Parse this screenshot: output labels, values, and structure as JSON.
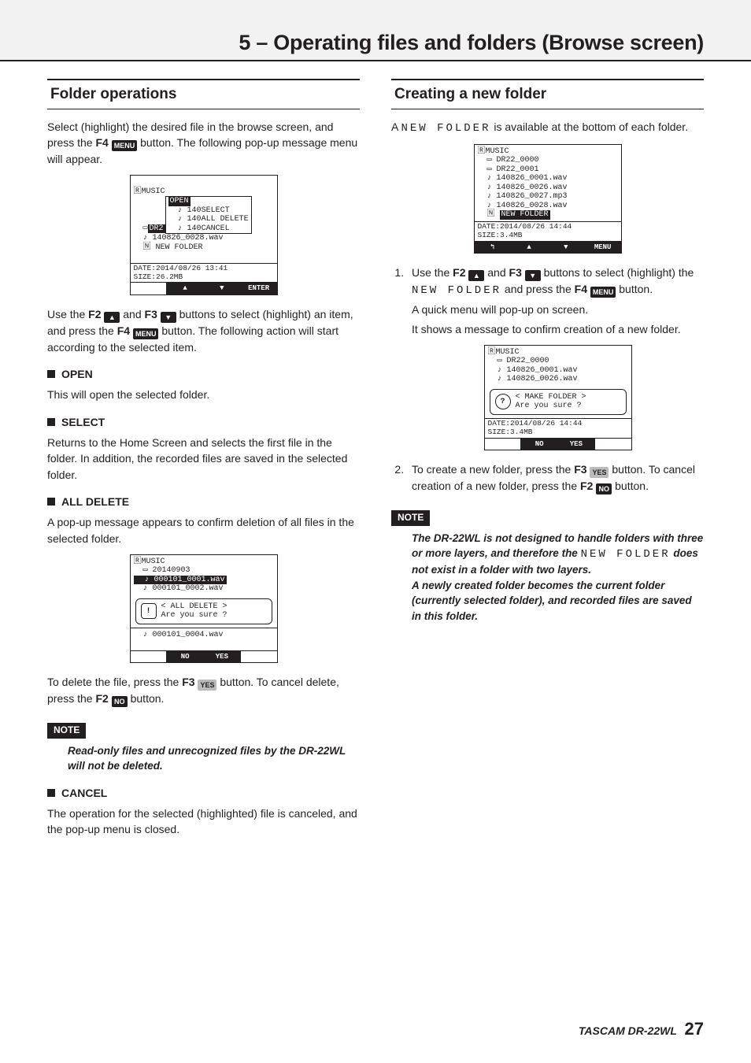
{
  "header": {
    "title": "5 – Operating files and folders (Browse screen)"
  },
  "left": {
    "h": "Folder operations",
    "intro_a": "Select (highlight) the desired file in the browse screen, and press the ",
    "intro_b_key": "F4",
    "intro_b_btn": "MENU",
    "intro_c": " button. The following pop-up message menu will appear.",
    "shot1": {
      "top": "🅁MUSIC",
      "l1f": "  ▭",
      "l1h": "DR2",
      "p1": "OPEN",
      "l2": "  ♪ 140",
      "p2": "SELECT",
      "l3": "  ♪ 140",
      "p3": "ALL DELETE",
      "l4": "  ♪ 140",
      "p4": "CANCEL",
      "l5": "  ♪ 140826_0028.wav",
      "l6": "  🄽 NEW FOLDER",
      "status": "DATE:2014/08/26 13:41\nSIZE:26.2MB",
      "f1": "",
      "f2": "▲",
      "f3": "▼",
      "f4": "ENTER"
    },
    "use_a": "Use the ",
    "use_f2": "F2",
    "use_up": "▲",
    "use_b": " and ",
    "use_f3": "F3",
    "use_dn": "▼",
    "use_c": " buttons to select (highlight) an item, and press the ",
    "use_f4": "F4",
    "use_menu": "MENU",
    "use_d": " button. The following action will start according to the selected item.",
    "open_h": "OPEN",
    "open_p": "This will open the selected folder.",
    "select_h": "SELECT",
    "select_p": "Returns to the Home Screen and selects the first file in the folder. In addition, the recorded files are saved in the selected folder.",
    "alldel_h": "ALL DELETE",
    "alldel_p": "A pop-up message appears to confirm deletion of all files in the selected folder.",
    "shot2": {
      "top": "🅁MUSIC",
      "l1": "  ▭ 20140903",
      "l2": "  ♪ 000101_0001.wav",
      "l3": "  ♪ 000101_0002.wav",
      "dlg_icon": "!",
      "dlg_l1": "< ALL DELETE >",
      "dlg_l2": "Are you sure ?",
      "l4": "  ♪ 000101_0004.wav",
      "f1": "",
      "f2": "NO",
      "f3": "YES",
      "f4": ""
    },
    "del_a": "To delete the file, press the ",
    "del_f3": "F3",
    "del_yes": "YES",
    "del_b": " button. To cancel delete, press the ",
    "del_f2": "F2",
    "del_no": "NO",
    "del_c": " button.",
    "note_label": "NOTE",
    "note_body": "Read-only files and unrecognized files by the DR-22WL will not be deleted.",
    "cancel_h": "CANCEL",
    "cancel_p": "The operation for the selected (highlighted) file is canceled, and the pop-up menu is closed."
  },
  "right": {
    "h": "Creating a new folder",
    "intro_a": "A ",
    "intro_nf": "NEW FOLDER",
    "intro_b": " is available at the bottom of each folder.",
    "shot3": {
      "top": "🅁MUSIC",
      "l1": "  ▭ DR22_0000",
      "l2": "  ▭ DR22_0001",
      "l3": "  ♪ 140826_0001.wav",
      "l4": "  ♪ 140826_0026.wav",
      "l5": "  ♪ 140826_0027.mp3",
      "l6": "  ♪ 140826_0028.wav",
      "l7_pre": "  🄽 ",
      "l7_inv": "NEW FOLDER",
      "status": "DATE:2014/08/26 14:44\nSIZE:3.4MB",
      "f1": "↰",
      "f2": "▲",
      "f3": "▼",
      "f4": "MENU"
    },
    "step1_a": "Use the ",
    "step1_f2": "F2",
    "step1_up": "▲",
    "step1_b": " and ",
    "step1_f3": "F3",
    "step1_dn": "▼",
    "step1_c": " buttons to select (highlight) the ",
    "step1_nf": "NEW FOLDER",
    "step1_d": " and press the ",
    "step1_f4": "F4",
    "step1_menu": "MENU",
    "step1_e": " button.",
    "step1_sub1": "A quick menu will pop-up on screen.",
    "step1_sub2": "It shows a message to confirm creation of a new folder.",
    "shot4": {
      "top": "🅁MUSIC",
      "l1": "  ▭ DR22_0000",
      "l2": "  ♪ 140826_0001.wav",
      "l3": "  ♪ 140826_0026.wav",
      "dlg_icon": "?",
      "dlg_l1": "< MAKE FOLDER >",
      "dlg_l2": "Are you sure ?",
      "status": "DATE:2014/08/26 14:44\nSIZE:3.4MB",
      "f1": "",
      "f2": "NO",
      "f3": "YES",
      "f4": ""
    },
    "step2_a": "To create a new folder, press the ",
    "step2_f3": "F3",
    "step2_yes": "YES",
    "step2_b": " button. To cancel creation of a new folder, press the ",
    "step2_f2": "F2",
    "step2_no": "NO",
    "step2_c": " button.",
    "note_label": "NOTE",
    "note1_a": "The DR-22WL is not designed to handle folders with three or more layers, and therefore the ",
    "note1_nf": "NEW FOLDER",
    "note1_b": " does not exist in a folder with two layers.",
    "note2": "A newly created folder becomes the current folder (currently selected folder), and recorded files are saved in this folder."
  },
  "footer": {
    "brand": "TASCAM  DR-22WL",
    "page": "27"
  }
}
